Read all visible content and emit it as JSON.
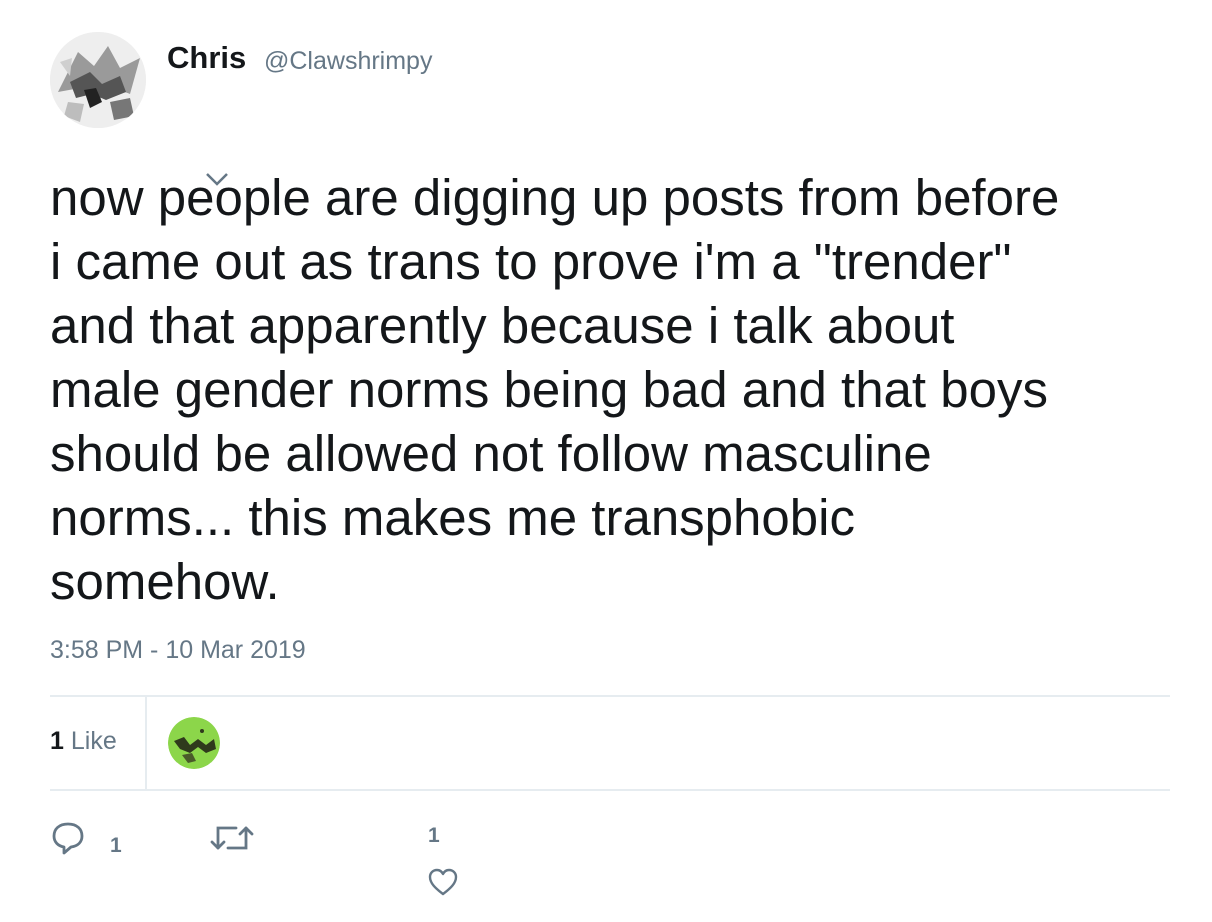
{
  "author": {
    "name": "Chris",
    "handle": "@Clawshrimpy"
  },
  "tweet": {
    "text": "now people are digging up posts from before\ni came out as trans to prove i'm a \"trender\"\nand that apparently because i talk about\nmale gender norms being bad and that boys\nshould be allowed not follow masculine\nnorms... this makes me transphobic\nsomehow.",
    "timestamp": "3:58 PM - 10 Mar 2019"
  },
  "stats": {
    "like_count": "1",
    "like_label": "Like"
  },
  "actions": {
    "reply_count": "1",
    "like_count": "1"
  },
  "icons": {
    "menu": "chevron-down-icon",
    "reply": "reply-icon",
    "retweet": "retweet-icon",
    "like": "heart-icon"
  },
  "colors": {
    "text": "#14171a",
    "secondary": "#657786",
    "divider": "#e6ecf0",
    "liker_avatar": "#8cd64a"
  }
}
